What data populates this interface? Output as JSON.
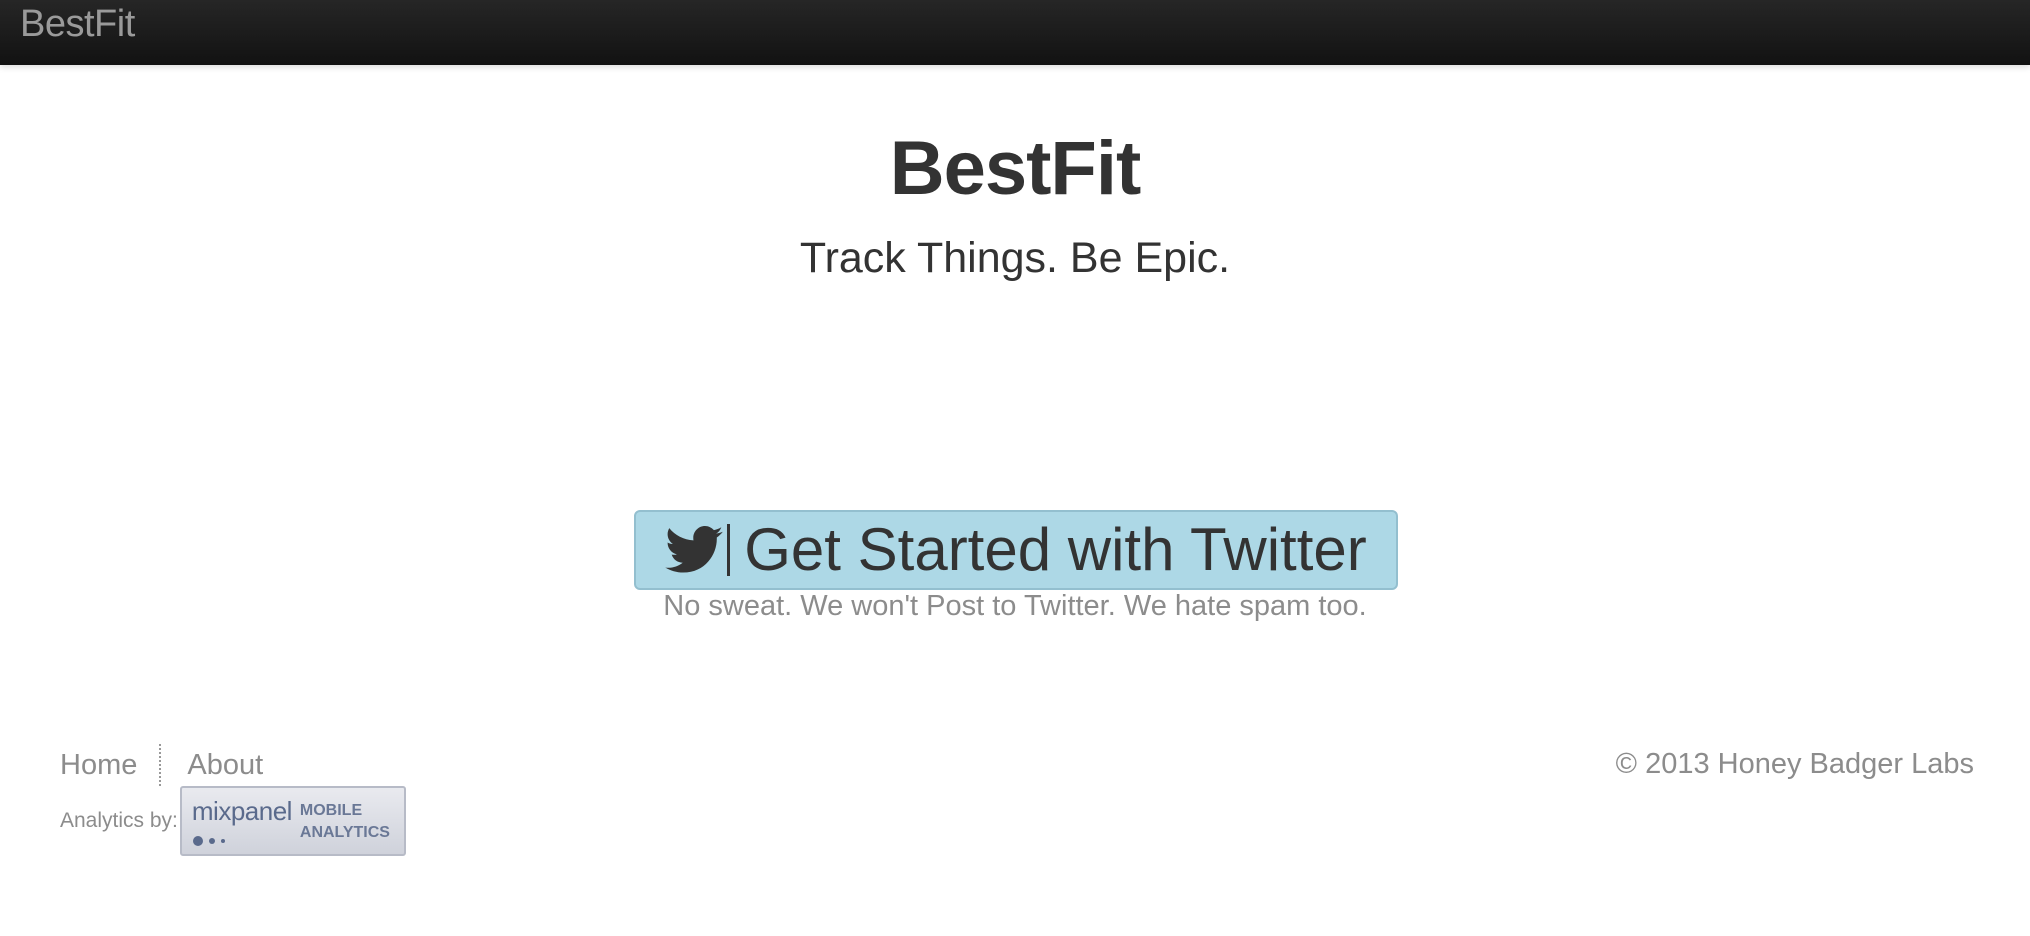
{
  "navbar": {
    "brand": "BestFit"
  },
  "hero": {
    "title": "BestFit",
    "tagline": "Track Things. Be Epic."
  },
  "cta": {
    "icon": "twitter-bird-icon",
    "label": "Get Started with Twitter",
    "note": "No sweat. We won't Post to Twitter. We hate spam too."
  },
  "footer": {
    "nav": [
      {
        "label": "Home"
      },
      {
        "label": "About"
      }
    ],
    "analytics_label": "Analytics by:",
    "badge": {
      "brand": "mixpanel",
      "line1": "MOBILE",
      "line2": "ANALYTICS"
    },
    "copyright": "© 2013 Honey Badger Labs"
  },
  "colors": {
    "navbar_bg": "#1b1b1b",
    "cta_bg": "#add8e6",
    "text_dark": "#333333",
    "text_muted": "#8c8c8c"
  }
}
